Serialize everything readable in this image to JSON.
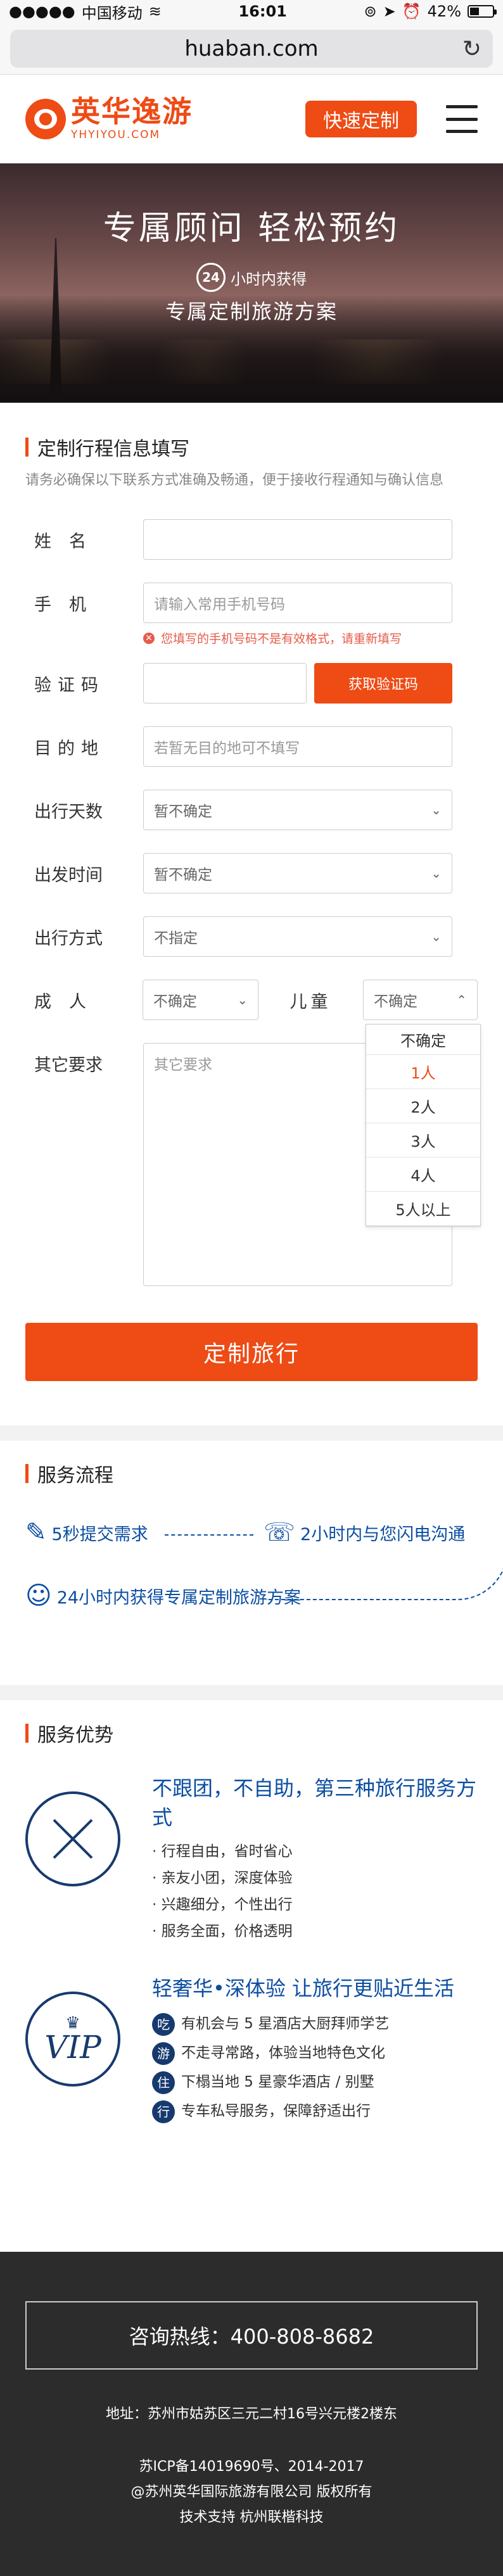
{
  "status_bar": {
    "carrier": "中国移动",
    "time": "16:01",
    "battery": "42%",
    "battery_level": 0.42
  },
  "browser": {
    "url": "huaban.com"
  },
  "header": {
    "logo_cn": "英华逸游",
    "logo_en": "YHYIYOU.COM",
    "cta_label": "快速定制"
  },
  "hero": {
    "title": "专属顾问  轻松预约",
    "badge_num": "24",
    "badge_text": "小时内获得",
    "subtitle": "专属定制旅游方案"
  },
  "form": {
    "title": "定制行程信息填写",
    "note": "请务必确保以下联系方式准确及畅通，便于接收行程通知与确认信息",
    "name_label": "姓名",
    "phone_label": "手机",
    "phone_placeholder": "请输入常用手机号码",
    "phone_error": "您填写的手机号码不是有效格式，请重新填写",
    "code_label": "验证码",
    "code_button": "获取验证码",
    "dest_label": "目的地",
    "dest_placeholder": "若暂无目的地可不填写",
    "days_label": "出行天数",
    "days_value": "暂不确定",
    "date_label": "出发时间",
    "date_value": "暂不确定",
    "mode_label": "出行方式",
    "mode_value": "不指定",
    "adult_label": "成人",
    "adult_value": "不确定",
    "child_label": "儿童",
    "child_value": "不确定",
    "child_options": [
      "不确定",
      "1人",
      "2人",
      "3人",
      "4人",
      "5人以上"
    ],
    "child_selected_option": "1人",
    "other_label": "其它要求",
    "other_placeholder": "其它要求",
    "submit_label": "定制旅行"
  },
  "process": {
    "title": "服务流程",
    "step1": "5秒提交需求",
    "step2": "2小时内与您闪电沟通",
    "step3": "24小时内获得专属定制旅游方案"
  },
  "advantages": {
    "title": "服务优势",
    "item1_title": "不跟团，不自助，第三种旅行服务方式",
    "item1_points": [
      "· 行程自由，省时省心",
      "· 亲友小团，深度体验",
      "· 兴趣细分，个性出行",
      "· 服务全面，价格透明"
    ],
    "item2_title": "轻奢华•深体验 让旅行更贴近生活",
    "item2_points": [
      {
        "tag": "吃",
        "text": "有机会与 5 星酒店大厨拜师学艺"
      },
      {
        "tag": "游",
        "text": "不走寻常路，体验当地特色文化"
      },
      {
        "tag": "住",
        "text": "下榻当地 5 星豪华酒店 / 别墅"
      },
      {
        "tag": "行",
        "text": "专车私导服务，保障舒适出行"
      }
    ],
    "vip_text": "VIP"
  },
  "footer": {
    "hotline": "咨询热线：400-808-8682",
    "address": "地址：苏州市姑苏区三元二村16号兴元楼2楼东",
    "icp": "苏ICP备14019690号、2014-2017",
    "copyright": "@苏州英华国际旅游有限公司 版权所有",
    "support": "技术支持  杭州联楷科技"
  }
}
